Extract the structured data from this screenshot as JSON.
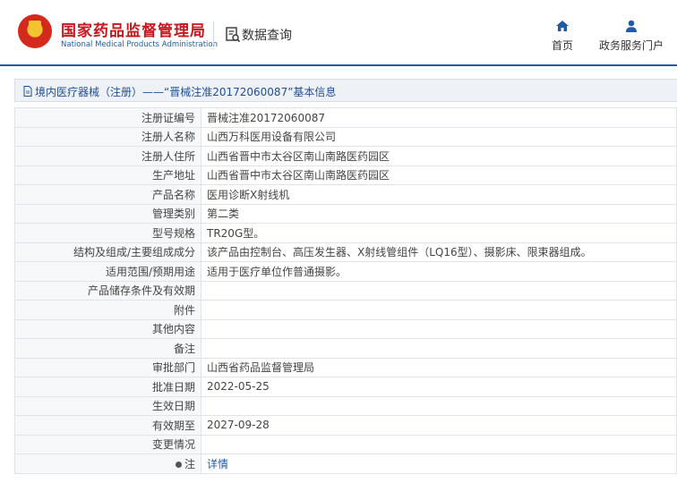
{
  "header": {
    "brand_cn": "国家药品监督管理局",
    "brand_en": "National Medical Products Administration",
    "query_label": "数据查询",
    "nav": {
      "home": "首页",
      "portal": "政务服务门户"
    }
  },
  "page_title": "境内医疗器械（注册）——“晋械注准20172060087”基本信息",
  "rows": [
    {
      "label": "注册证编号",
      "value": "晋械注准20172060087"
    },
    {
      "label": "注册人名称",
      "value": "山西万科医用设备有限公司"
    },
    {
      "label": "注册人住所",
      "value": "山西省晋中市太谷区南山南路医药园区"
    },
    {
      "label": "生产地址",
      "value": "山西省晋中市太谷区南山南路医药园区"
    },
    {
      "label": "产品名称",
      "value": "医用诊断X射线机"
    },
    {
      "label": "管理类别",
      "value": "第二类"
    },
    {
      "label": "型号规格",
      "value": "TR20G型。"
    },
    {
      "label": "结构及组成/主要组成成分",
      "value": "该产品由控制台、高压发生器、X射线管组件（LQ16型）、摄影床、限束器组成。"
    },
    {
      "label": "适用范围/预期用途",
      "value": "适用于医疗单位作普通摄影。"
    },
    {
      "label": "产品储存条件及有效期",
      "value": ""
    },
    {
      "label": "附件",
      "value": ""
    },
    {
      "label": "其他内容",
      "value": ""
    },
    {
      "label": "备注",
      "value": ""
    },
    {
      "label": "审批部门",
      "value": "山西省药品监督管理局"
    },
    {
      "label": "批准日期",
      "value": "2022-05-25"
    },
    {
      "label": "生效日期",
      "value": ""
    },
    {
      "label": "有效期至",
      "value": "2027-09-28"
    },
    {
      "label": "变更情况",
      "value": ""
    }
  ],
  "note_row": {
    "label": "注",
    "link_text": "详情"
  },
  "colors": {
    "brand_red": "#c8161d",
    "brand_blue": "#1f5ba8",
    "label_bg": "#f7f8fa"
  }
}
